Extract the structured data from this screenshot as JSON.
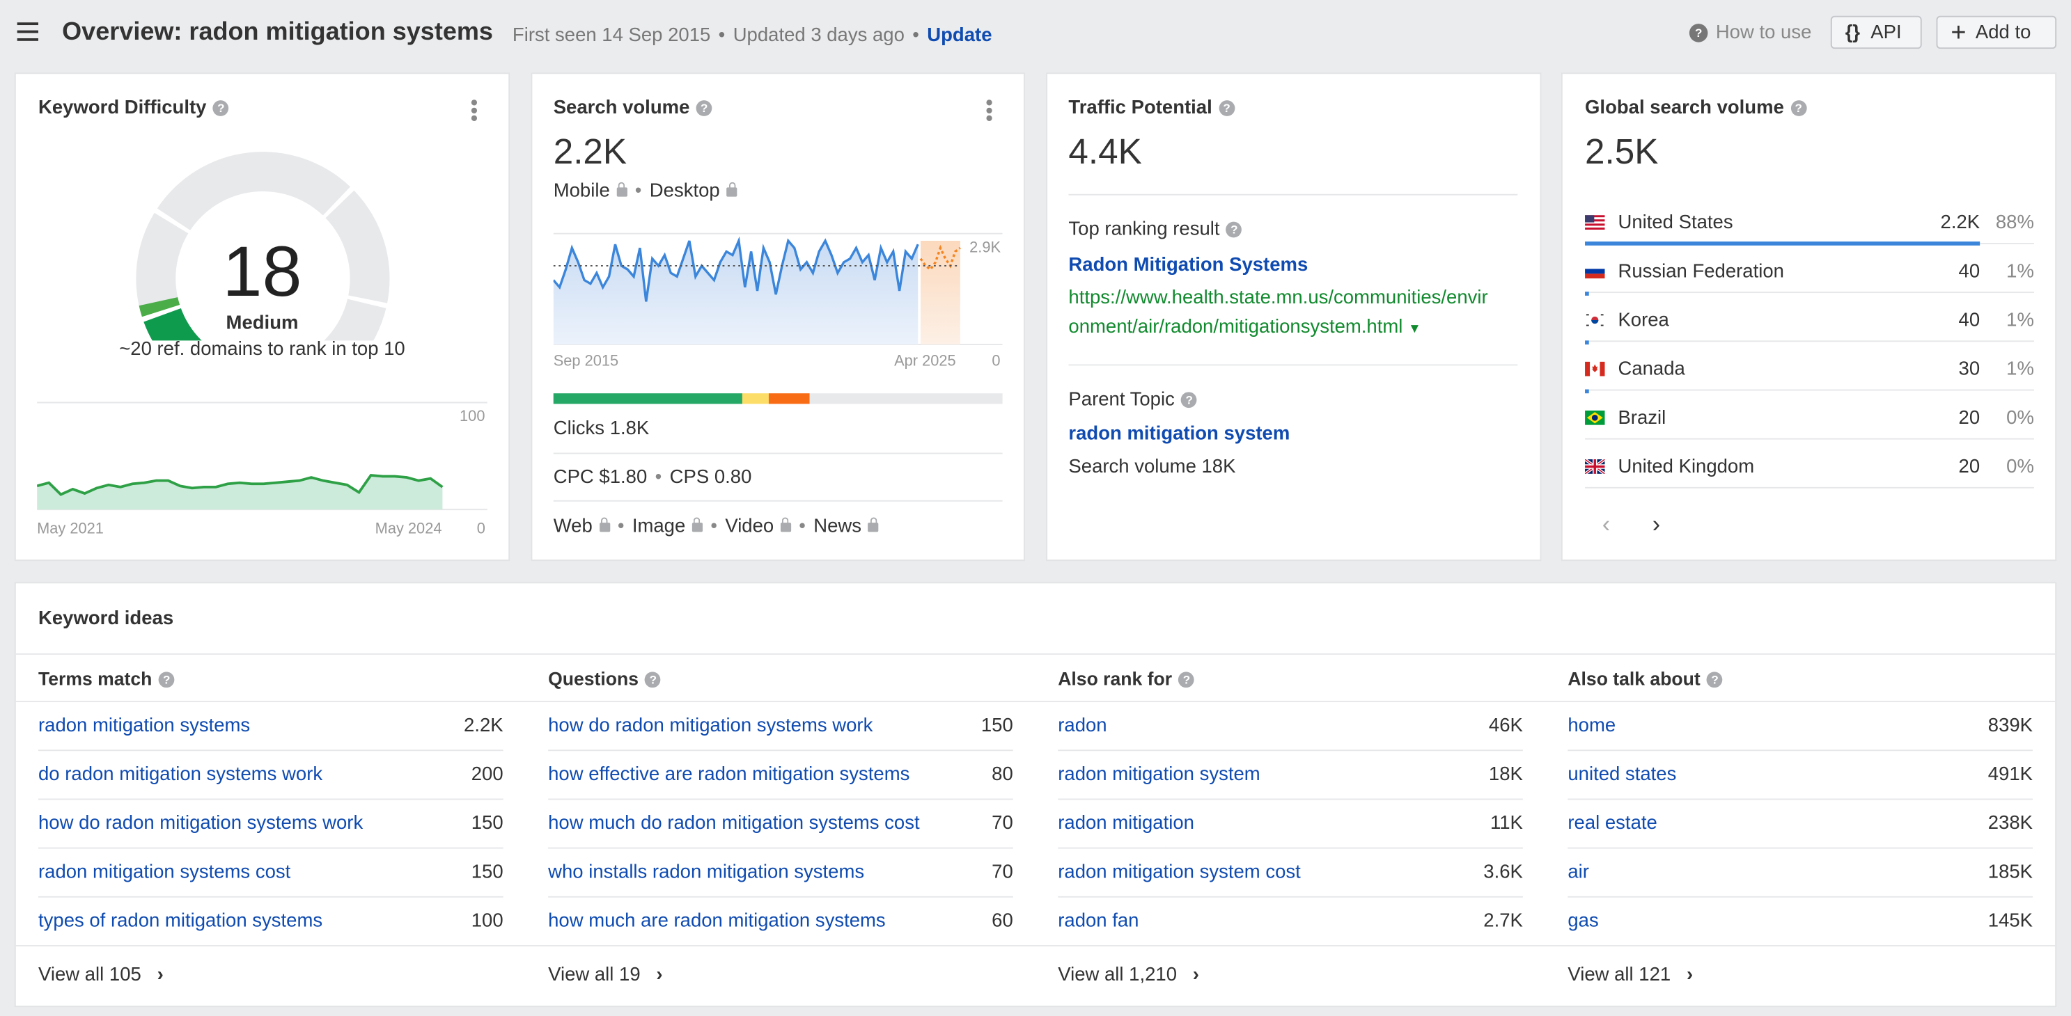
{
  "header": {
    "menu_icon": "hamburger-icon",
    "title": "Overview: radon mitigation systems",
    "first_seen": "First seen 14 Sep 2015",
    "updated": "Updated 3 days ago",
    "update_link": "Update",
    "how_to_use": "How to use",
    "api_label": "API",
    "add_to_label": "Add to"
  },
  "kd": {
    "title": "Keyword Difficulty",
    "value": "18",
    "score": 18,
    "level": "Medium",
    "hint": "~20 ref. domains to rank in top 10",
    "chart": {
      "y_max_label": "100",
      "y_min_label": "0",
      "x_start": "May 2021",
      "x_end": "May 2024",
      "ylim": [
        0,
        100
      ],
      "values": [
        22,
        25,
        14,
        19,
        15,
        20,
        23,
        21,
        24,
        25,
        27,
        27,
        22,
        20,
        21,
        21,
        24,
        25,
        24,
        24,
        25,
        26,
        27,
        30,
        27,
        25,
        23,
        16,
        32,
        31,
        31,
        30,
        27,
        29,
        21
      ]
    }
  },
  "sv": {
    "title": "Search volume",
    "value": "2.2K",
    "mobile": "Mobile",
    "desktop": "Desktop",
    "chart": {
      "y_max_label": "2.9K",
      "y_min_label": "0",
      "x_start": "Sep 2015",
      "x_end": "Apr 2025",
      "ylim": [
        0,
        3100
      ],
      "average": 2200,
      "values": [
        1800,
        1600,
        2100,
        2700,
        2300,
        1800,
        1700,
        2000,
        1600,
        1900,
        2800,
        2200,
        2100,
        1900,
        2700,
        1200,
        2400,
        2200,
        2500,
        2000,
        1900,
        2400,
        2900,
        1900,
        2200,
        2000,
        1800,
        2300,
        2600,
        2500,
        2900,
        1600,
        2600,
        1500,
        2700,
        2300,
        1400,
        2200,
        2900,
        2700,
        2100,
        2300,
        2000,
        2600,
        2900,
        2500,
        2000,
        2300,
        2400,
        2700,
        2300,
        2500,
        1800,
        2700,
        2300,
        2600,
        1500,
        2600,
        2400,
        2800
      ],
      "forecast": [
        2400,
        2200,
        2100,
        2300,
        2700,
        2400,
        2200,
        2600,
        2700
      ],
      "intent_bar": [
        {
          "share": 0.42,
          "color": "#25a865"
        },
        {
          "share": 0.06,
          "color": "#fcdd67"
        },
        {
          "share": 0.09,
          "color": "#f96c16"
        },
        {
          "share": 0.43,
          "color": "#e8e9eb"
        }
      ]
    },
    "clicks": "Clicks 1.8K",
    "cpc": "CPC $1.80",
    "cps": "CPS 0.80",
    "web": "Web",
    "image": "Image",
    "video": "Video",
    "news": "News"
  },
  "tp": {
    "title": "Traffic Potential",
    "value": "4.4K",
    "top_label": "Top ranking result",
    "top_title": "Radon Mitigation Systems",
    "top_url_1": "https://www.health.state.mn.us/communities/envir",
    "top_url_2": "onment/air/radon/mitigationsystem.html",
    "parent_label": "Parent Topic",
    "parent_topic": "radon mitigation system",
    "parent_volume": "Search volume 18K"
  },
  "gsv": {
    "title": "Global search volume",
    "value": "2.5K",
    "countries": [
      {
        "name": "United States",
        "volume": "2.2K",
        "pct": "88%",
        "share": 0.88,
        "flag": "us"
      },
      {
        "name": "Russian Federation",
        "volume": "40",
        "pct": "1%",
        "share": 0.01,
        "flag": "ru"
      },
      {
        "name": "Korea",
        "volume": "40",
        "pct": "1%",
        "share": 0.01,
        "flag": "kr"
      },
      {
        "name": "Canada",
        "volume": "30",
        "pct": "1%",
        "share": 0.01,
        "flag": "ca"
      },
      {
        "name": "Brazil",
        "volume": "20",
        "pct": "0%",
        "share": 0.0,
        "flag": "br"
      },
      {
        "name": "United Kingdom",
        "volume": "20",
        "pct": "0%",
        "share": 0.0,
        "flag": "gb"
      }
    ]
  },
  "ideas": {
    "title": "Keyword ideas",
    "columns": [
      {
        "title": "Terms match",
        "view_all": "View all 105",
        "rows": [
          [
            "radon mitigation systems",
            "2.2K"
          ],
          [
            "do radon mitigation systems work",
            "200"
          ],
          [
            "how do radon mitigation systems work",
            "150"
          ],
          [
            "radon mitigation systems cost",
            "150"
          ],
          [
            "types of radon mitigation systems",
            "100"
          ]
        ]
      },
      {
        "title": "Questions",
        "view_all": "View all 19",
        "rows": [
          [
            "how do radon mitigation systems work",
            "150"
          ],
          [
            "how effective are radon mitigation systems",
            "80"
          ],
          [
            "how much do radon mitigation systems cost",
            "70"
          ],
          [
            "who installs radon mitigation systems",
            "70"
          ],
          [
            "how much are radon mitigation systems",
            "60"
          ]
        ]
      },
      {
        "title": "Also rank for",
        "view_all": "View all 1,210",
        "rows": [
          [
            "radon",
            "46K"
          ],
          [
            "radon mitigation system",
            "18K"
          ],
          [
            "radon mitigation",
            "11K"
          ],
          [
            "radon mitigation system cost",
            "3.6K"
          ],
          [
            "radon fan",
            "2.7K"
          ]
        ]
      },
      {
        "title": "Also talk about",
        "view_all": "View all 121",
        "rows": [
          [
            "home",
            "839K"
          ],
          [
            "united states",
            "491K"
          ],
          [
            "real estate",
            "238K"
          ],
          [
            "air",
            "185K"
          ],
          [
            "gas",
            "145K"
          ]
        ]
      }
    ]
  },
  "colors": {
    "link": "#0f4bb0",
    "url_green": "#118a2e",
    "sv_line": "#3b86db",
    "forecast": "#f5841f",
    "kd_green": "#27a349"
  }
}
